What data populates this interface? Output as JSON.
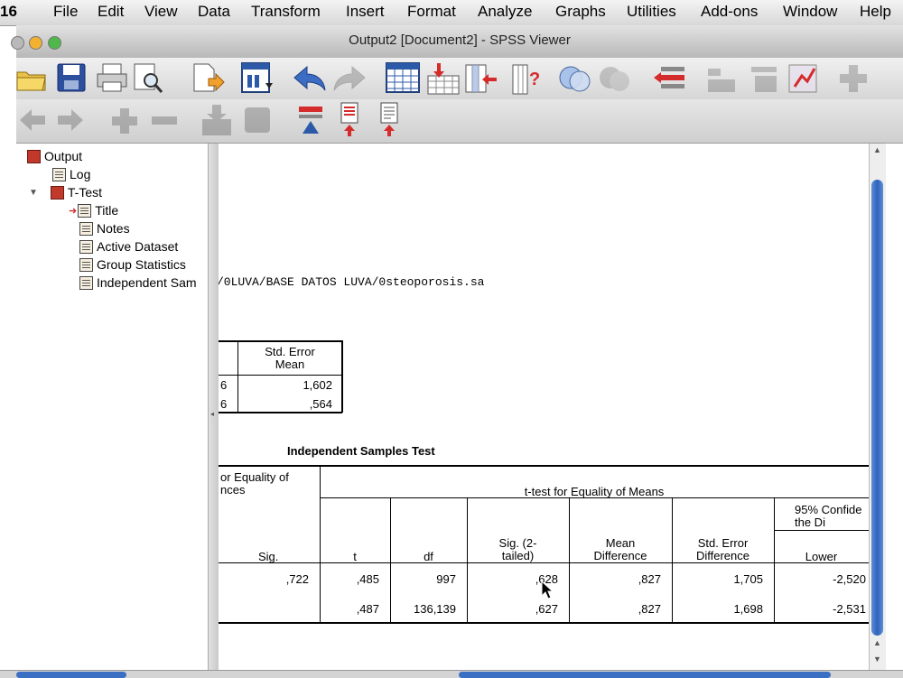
{
  "menubar": {
    "app_fragment": "16",
    "items": [
      "File",
      "Edit",
      "View",
      "Data",
      "Transform",
      "Insert",
      "Format",
      "Analyze",
      "Graphs",
      "Utilities",
      "Add-ons",
      "Window",
      "Help"
    ]
  },
  "window": {
    "title": "Output2 [Document2] - SPSS Viewer"
  },
  "outline": {
    "root": "Output",
    "log": "Log",
    "procedure": "T-Test",
    "items": [
      "Title",
      "Notes",
      "Active Dataset",
      "Group Statistics",
      "Independent Sam"
    ]
  },
  "syntax_path": "/0LUVA/BASE DATOS LUVA/0steoporosis.sa",
  "group_stats": {
    "header": "Std. Error\nMean",
    "rows": [
      {
        "n_fragment": "6",
        "se": "1,602"
      },
      {
        "n_fragment": "6",
        "se": ",564"
      }
    ]
  },
  "ind_test": {
    "title": "Independent Samples Test",
    "levene_header": "or Equality of\nnces",
    "ttest_header": "t-test for Equality of Means",
    "ci_header": "95% Confide\nthe Di",
    "cols": {
      "sig": "Sig.",
      "t": "t",
      "df": "df",
      "sig2": "Sig. (2-\ntailed)",
      "mean_diff": "Mean\nDifference",
      "se_diff": "Std. Error\nDifference",
      "lower": "Lower"
    },
    "rows": [
      {
        "sig": ",722",
        "t": ",485",
        "df": "997",
        "sig2": ",628",
        "mean_diff": ",827",
        "se_diff": "1,705",
        "lower": "-2,520"
      },
      {
        "sig": "",
        "t": ",487",
        "df": "136,139",
        "sig2": ",627",
        "mean_diff": ",827",
        "se_diff": "1,698",
        "lower": "-2,531"
      }
    ]
  }
}
